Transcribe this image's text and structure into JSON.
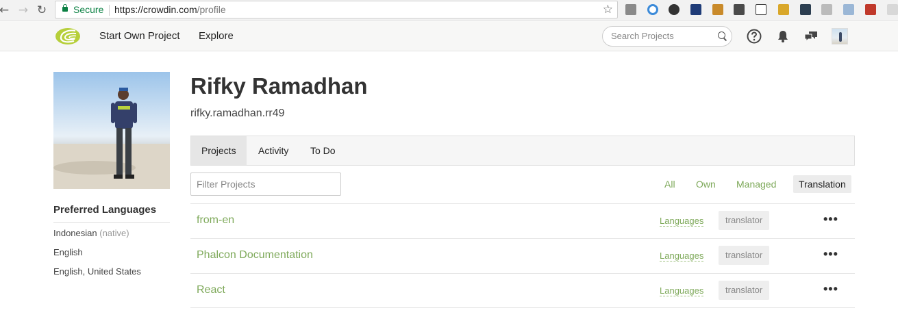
{
  "browser": {
    "secure_label": "Secure",
    "url_host": "https://crowdin.com",
    "url_path": "/profile"
  },
  "header": {
    "nav": [
      "Start Own Project",
      "Explore"
    ],
    "search_placeholder": "Search Projects"
  },
  "profile": {
    "name": "Rifky Ramadhan",
    "username": "rifky.ramadhan.rr49",
    "preferred_title": "Preferred Languages",
    "languages": [
      {
        "name": "Indonesian",
        "note": "(native)"
      },
      {
        "name": "English",
        "note": ""
      },
      {
        "name": "English, United States",
        "note": ""
      }
    ]
  },
  "tabs": [
    "Projects",
    "Activity",
    "To Do"
  ],
  "filter": {
    "placeholder": "Filter Projects",
    "options": [
      "All",
      "Own",
      "Managed",
      "Translation"
    ],
    "active": "Translation"
  },
  "projects": [
    {
      "name": "from-en",
      "languages_label": "Languages",
      "role": "translator"
    },
    {
      "name": "Phalcon Documentation",
      "languages_label": "Languages",
      "role": "translator"
    },
    {
      "name": "React",
      "languages_label": "Languages",
      "role": "translator"
    }
  ],
  "colors": {
    "accent_green": "#7ea95a",
    "secure_green": "#0b8043"
  }
}
